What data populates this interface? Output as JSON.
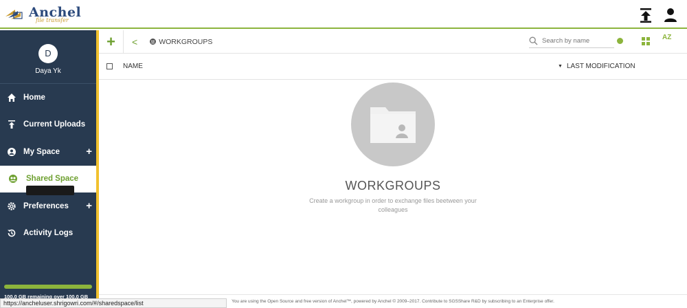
{
  "app": {
    "logo_title": "Anchel",
    "logo_subtitle": "file transfer"
  },
  "topbar": {
    "upload_icon": "upload-icon",
    "profile_icon": "user-icon"
  },
  "sidebar": {
    "avatar_initial": "D",
    "username": "Daya Yk",
    "items": [
      {
        "label": "Home",
        "icon": "home-icon"
      },
      {
        "label": "Current Uploads",
        "icon": "upload-icon"
      },
      {
        "label": "My Space",
        "icon": "user-circle-icon"
      },
      {
        "label": "Shared Space",
        "icon": "shared-icon"
      },
      {
        "label": "Preferences",
        "icon": "gear-icon"
      },
      {
        "label": "Activity Logs",
        "icon": "history-icon"
      }
    ],
    "quota_text": "100.0 GB remaining over 100.0 GB",
    "quota_fraction": 1.0
  },
  "toolbar": {
    "add_label": "+",
    "back_label": "<",
    "breadcrumb": "WORKGROUPS",
    "search_placeholder": "Search by name",
    "sort_label": "AZ"
  },
  "list": {
    "col_name": "NAME",
    "col_modification": "LAST MODIFICATION"
  },
  "empty_state": {
    "title": "WORKGROUPS",
    "description_line1": "Create a workgroup in order to exchange files beetween your",
    "description_line2": "colleagues"
  },
  "footer": {
    "text": "You are using the Open Source and free version of Anchel™, powered by Anchel © 2009–2017. Contribute to SGSShare R&D by subscribing to an Enterprise offer."
  },
  "status_bar": {
    "url": "https://ancheluser.shrigowri.com/#/sharedspace/list"
  },
  "colors": {
    "sidebar_bg": "#283a50",
    "accent_green": "#8cb43c",
    "accent_yellow": "#f2c12e",
    "empty_circle": "#c8c8c8"
  }
}
